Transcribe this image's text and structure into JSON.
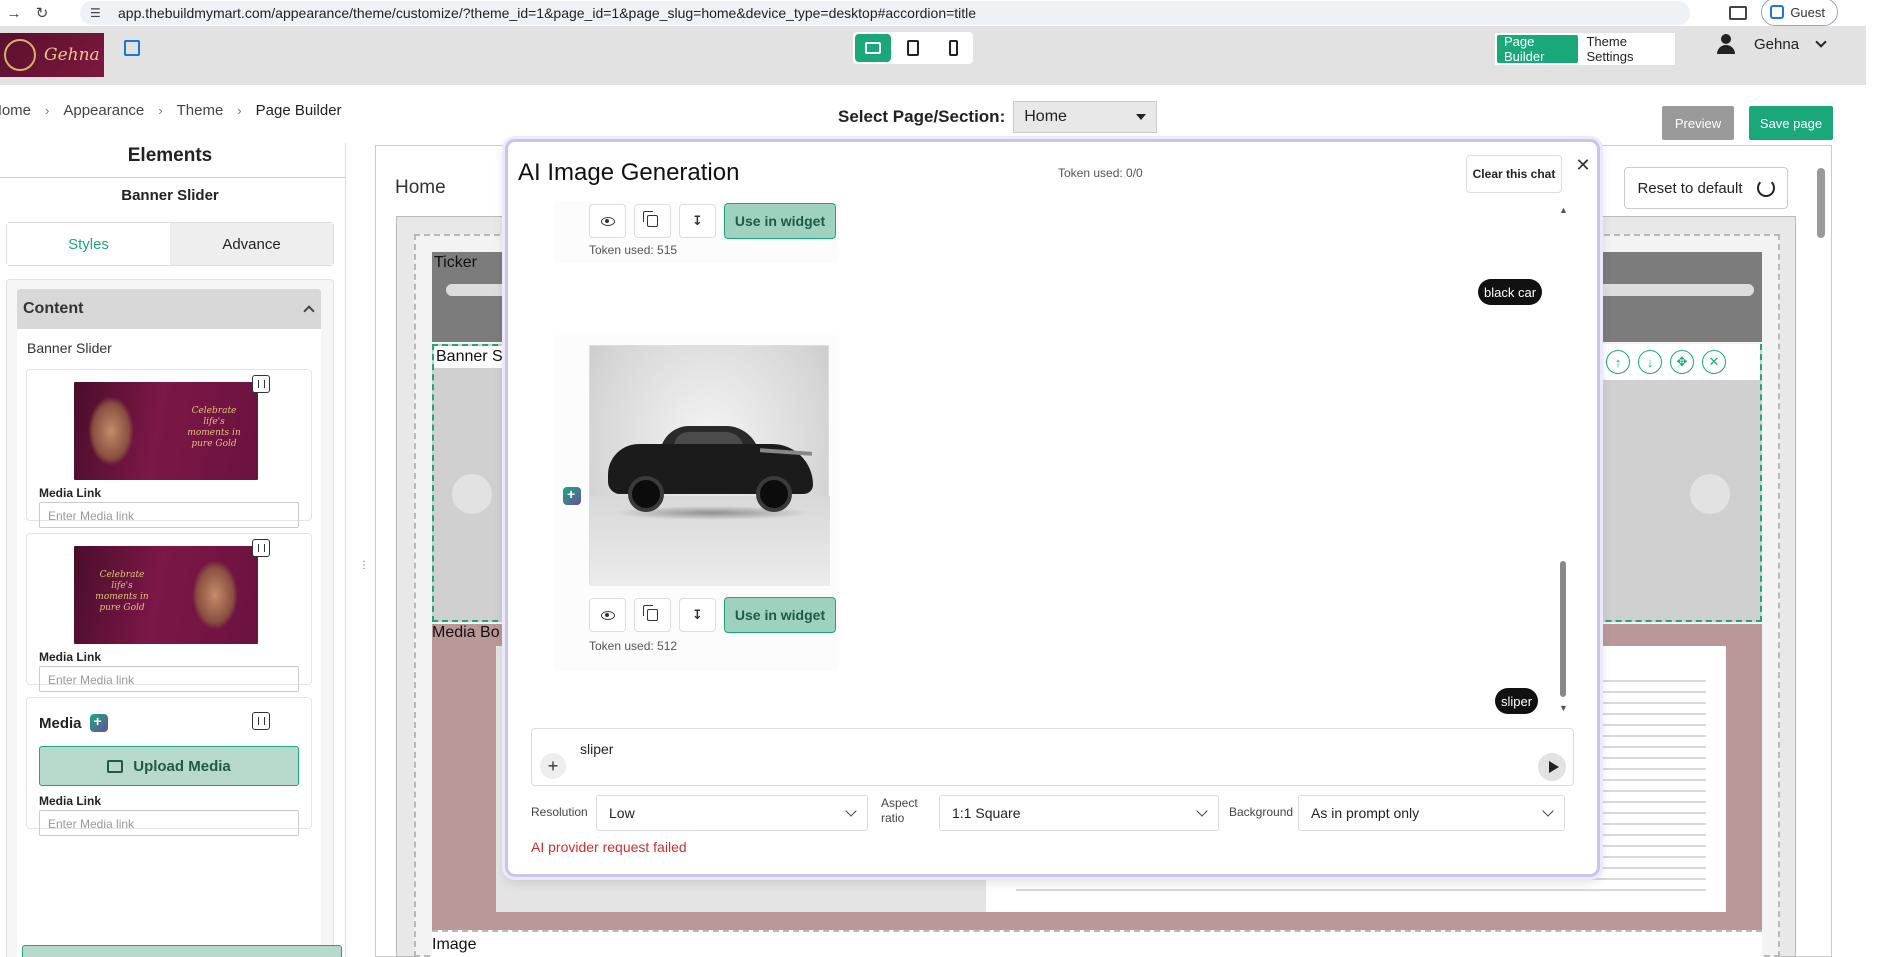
{
  "browser": {
    "url": "app.thebuildmymart.com/appearance/theme/customize/?theme_id=1&page_id=1&page_slug=home&device_type=desktop#accordion=title",
    "profile_label": "Guest"
  },
  "header": {
    "logo_text": "Gehna",
    "page_builder_label": "Page Builder",
    "theme_settings_label": "Theme Settings",
    "user_name": "Gehna"
  },
  "breadcrumb": {
    "items": [
      "Home",
      "Appearance",
      "Theme",
      "Page Builder"
    ]
  },
  "page_select": {
    "label": "Select Page/Section:",
    "value": "Home"
  },
  "actions": {
    "preview": "Preview",
    "save": "Save page"
  },
  "left_panel": {
    "title": "Elements",
    "subtitle": "Banner Slider",
    "tabs": [
      "Styles",
      "Advance"
    ],
    "content_header": "Content",
    "section_label": "Banner Slider",
    "banner_cards": [
      {
        "overlay_text": "Celebrate life's moments in pure Gold",
        "media_link_label": "Media Link",
        "media_link_placeholder": "Enter Media link"
      },
      {
        "overlay_text": "Celebrate life's moments in pure Gold",
        "media_link_label": "Media Link",
        "media_link_placeholder": "Enter Media link"
      }
    ],
    "media_label": "Media",
    "upload_label": "Upload Media",
    "media_link_label": "Media Link",
    "media_link_placeholder": "Enter Media link"
  },
  "canvas": {
    "title": "Home",
    "reset_label": "Reset to default",
    "sections": {
      "ticker": "Ticker",
      "banner": "Banner Sl",
      "media": "Media Bo",
      "image": "Image"
    }
  },
  "modal": {
    "title": "AI Image Generation",
    "token_used": "Token used: 0/0",
    "clear_label": "Clear this chat",
    "use_label": "Use in widget",
    "messages": [
      {
        "token": "Token used: 515"
      },
      {
        "user_prompt": "black car"
      },
      {
        "token": "Token used: 512"
      },
      {
        "user_prompt": "sliper"
      }
    ],
    "input_value": "sliper",
    "options": {
      "resolution_label": "Resolution",
      "resolution_value": "Low",
      "aspect_label": "Aspect ratio",
      "aspect_value": "1:1 Square",
      "background_label": "Background",
      "background_value": "As in prompt only"
    },
    "error": "AI provider request failed"
  },
  "colors": {
    "accent": "#1aa87a",
    "error": "#d32f2f",
    "brand": "#5a0f2c"
  }
}
